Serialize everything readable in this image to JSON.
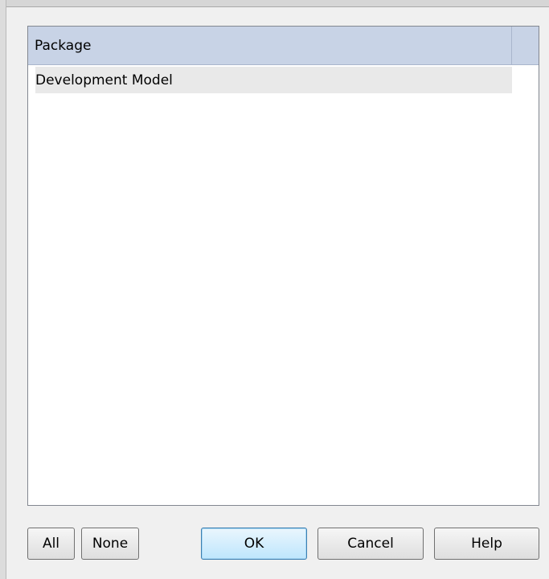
{
  "list": {
    "columns": [
      "Package"
    ],
    "rows": [
      {
        "label": "Development Model"
      }
    ]
  },
  "buttons": {
    "all": "All",
    "none": "None",
    "ok": "OK",
    "cancel": "Cancel",
    "help": "Help"
  }
}
